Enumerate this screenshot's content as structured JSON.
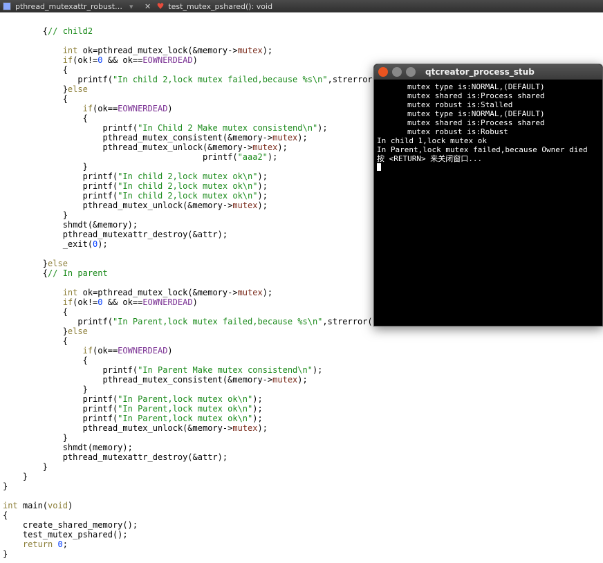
{
  "topbar": {
    "crumb1": "pthread_mutexattr_robust…",
    "crumb2": "test_mutex_pshared(): void"
  },
  "code": {
    "l01_c": "// child2",
    "l02_t": "int",
    "l02_i": "mutex",
    "l03_k": "if",
    "l03_n": "0",
    "l03_e": "EOWNERDEAD",
    "l04_s": "\"In child 2,lock mutex failed,because %s\\n\"",
    "l05_k": "else",
    "l06_k": "if",
    "l06_e": "EOWNERDEAD",
    "l07_s": "\"In Child 2 Make mutex consistend\\n\"",
    "l08_i": "mutex",
    "l09_i": "mutex",
    "l10_s": "\"aaa2\"",
    "l11_s": "\"In child 2,lock mutex ok\\n\"",
    "l12_s": "\"In child 2,lock mutex ok\\n\"",
    "l13_s": "\"In child 2,lock mutex ok\\n\"",
    "l14_i": "mutex",
    "l15_n": "0",
    "l16_k": "else",
    "l17_c": "// In parent",
    "l18_t": "int",
    "l18_i": "mutex",
    "l19_k": "if",
    "l19_n": "0",
    "l19_e": "EOWNERDEAD",
    "l20_s": "\"In Parent,lock mutex failed,because %s\\n\"",
    "l21_k": "else",
    "l22_k": "if",
    "l22_e": "EOWNERDEAD",
    "l23_s": "\"In Parent Make mutex consistend\\n\"",
    "l24_i": "mutex",
    "l25_s": "\"In Parent,lock mutex ok\\n\"",
    "l26_s": "\"In Parent,lock mutex ok\\n\"",
    "l27_s": "\"In Parent,lock mutex ok\\n\"",
    "l28_i": "mutex",
    "l29_t": "int",
    "l29_k": "void",
    "l30_k": "return",
    "l30_n": "0"
  },
  "terminal": {
    "title": "qtcreator_process_stub",
    "l1": "mutex type is:NORMAL,(DEFAULT)",
    "l2": "mutex shared is:Process shared",
    "l3": "mutex robust is:Stalled",
    "l4": "mutex type is:NORMAL,(DEFAULT)",
    "l5": "mutex shared is:Process shared",
    "l6": "mutex robust is:Robust",
    "l7": "In child 1,lock mutex ok",
    "l8": "In Parent,lock mutex failed,because Owner died",
    "l9": "按 <RETURN> 来关闭窗口..."
  }
}
